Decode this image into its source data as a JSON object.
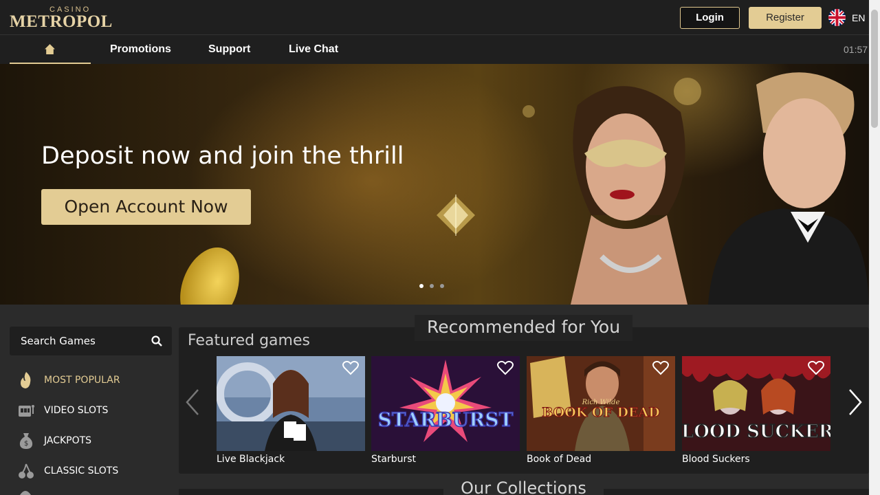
{
  "header": {
    "logo_small": "CASINO",
    "logo_main": "METROPOL",
    "login_label": "Login",
    "register_label": "Register",
    "language": "EN",
    "flag_icon": "uk-flag-icon"
  },
  "nav": {
    "home_icon": "home-icon",
    "items": [
      {
        "label": "Promotions"
      },
      {
        "label": "Support"
      },
      {
        "label": "Live Chat"
      }
    ],
    "clock": "01:57"
  },
  "hero": {
    "title": "Deposit now and join the thrill",
    "cta": "Open Account Now",
    "slides": 3,
    "active_slide": 1
  },
  "sidebar": {
    "search_placeholder": "Search Games",
    "categories": [
      {
        "label": "MOST POPULAR",
        "icon": "flame-icon",
        "active": true
      },
      {
        "label": "VIDEO SLOTS",
        "icon": "slot-machine-icon",
        "active": false
      },
      {
        "label": "JACKPOTS",
        "icon": "money-bag-icon",
        "active": false
      },
      {
        "label": "CLASSIC SLOTS",
        "icon": "cherries-icon",
        "active": false
      }
    ]
  },
  "games": {
    "recommended_title": "Recommended for You",
    "featured_title": "Featured games",
    "tiles": [
      {
        "name": "Live Blackjack",
        "art": ""
      },
      {
        "name": "Starburst",
        "art": "STARBURST"
      },
      {
        "name": "Book of Dead",
        "art": "BOOK OF DEAD",
        "art_small": "Rich Wilde"
      },
      {
        "name": "Blood Suckers",
        "art": "BLOOD SUCKERS"
      }
    ]
  },
  "collections": {
    "title": "Our Collections"
  },
  "colors": {
    "accent": "#e3cc94",
    "panel": "#1f1f1f",
    "background": "#2b2b2b"
  }
}
